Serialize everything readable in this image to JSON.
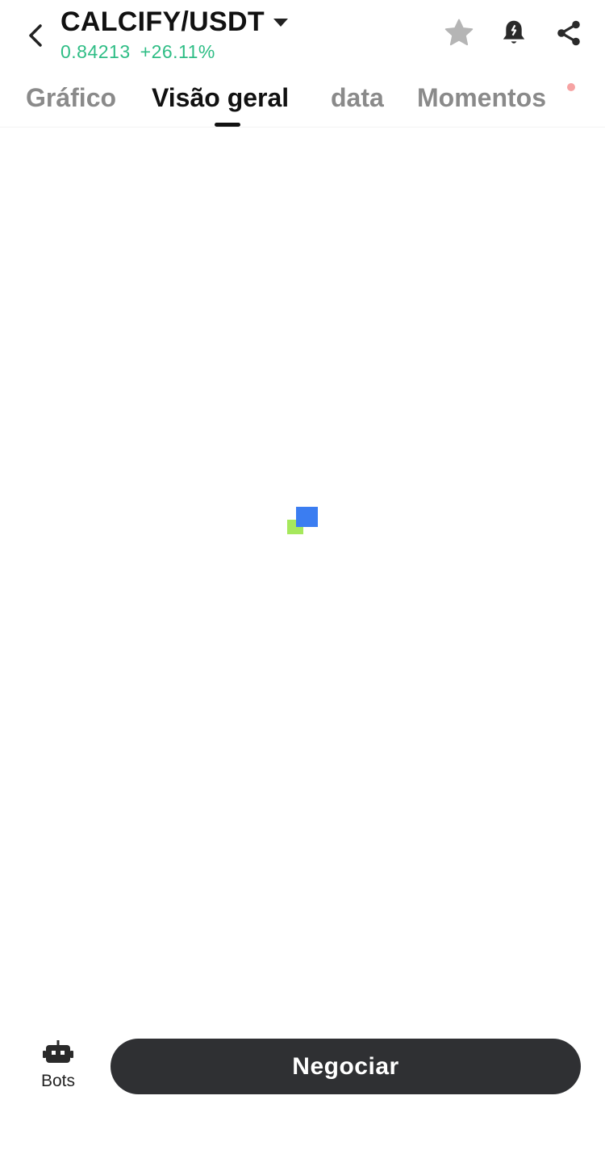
{
  "header": {
    "pair": "CALCIFY/USDT",
    "price": "0.84213",
    "change": "+26.11%",
    "icons": {
      "back": "chevron-left-icon",
      "dropdown": "caret-down-icon",
      "favorite": "star-icon",
      "alert": "bell-alert-icon",
      "share": "share-icon"
    }
  },
  "tabs": [
    {
      "label": "Gráfico"
    },
    {
      "label": "Visão geral"
    },
    {
      "label": "data"
    },
    {
      "label": "Momentos"
    }
  ],
  "active_tab_index": 1,
  "bottom": {
    "bots_label": "Bots",
    "trade_label": "Negociar"
  },
  "colors": {
    "up": "#2ebd85",
    "button_bg": "#2f3033",
    "loader_green": "#a6e85c",
    "loader_blue": "#3b7df1"
  }
}
